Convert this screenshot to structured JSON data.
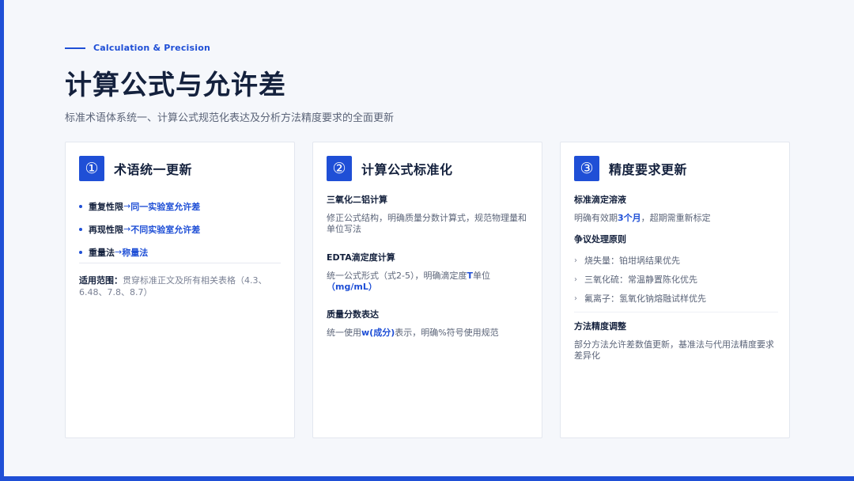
{
  "eyebrow": "Calculation & Precision",
  "title": "计算公式与允许差",
  "subtitle": "标准术语体系统一、计算公式规范化表达及分析方法精度要求的全面更新",
  "colors": {
    "accent": "#1f4fd6",
    "heading": "#14213d",
    "muted": "#5b6478",
    "background": "#f5f7fb"
  },
  "cards": [
    {
      "number": "①",
      "title": "术语统一更新",
      "bullets": [
        {
          "term": "重复性限",
          "arrow": "→",
          "new": "同一实验室允许差"
        },
        {
          "term": "再现性限",
          "arrow": "→",
          "new": "不同实验室允许差"
        },
        {
          "term": "重量法",
          "arrow": "→",
          "new": "称量法"
        }
      ],
      "scope_label": "适用范围：",
      "scope_text": "贯穿标准正文及所有相关表格（4.3、6.48、7.8、8.7）"
    },
    {
      "number": "②",
      "title": "计算公式标准化",
      "sections": [
        {
          "title": "三氧化二铝计算",
          "body": "修正公式结构，明确质量分数计算式，规范物理量和单位写法"
        },
        {
          "title": "EDTA滴定度计算",
          "body_a": "统一公式形式（式2-5），明确滴定度",
          "hl_a": "T",
          "body_b": "单位",
          "hl_b": "（mg/mL）"
        },
        {
          "title": "质量分数表达",
          "body_a": "统一使用",
          "hl_a": "w(成分)",
          "body_b": "表示，明确%符号使用规范"
        }
      ]
    },
    {
      "number": "③",
      "title": "精度要求更新",
      "s1_title": "标准滴定溶液",
      "s1_body_a": "明确有效期",
      "s1_hl": "3个月",
      "s1_body_b": "，超期需重新标定",
      "s2_title": "争议处理原则",
      "s2_items": [
        "烧失量：铂坩埚结果优先",
        "三氧化硫：常温静置陈化优先",
        "氟离子：氢氧化钠熔融试样优先"
      ],
      "s3_title": "方法精度调整",
      "s3_body": "部分方法允许差数值更新，基准法与代用法精度要求差异化"
    }
  ]
}
